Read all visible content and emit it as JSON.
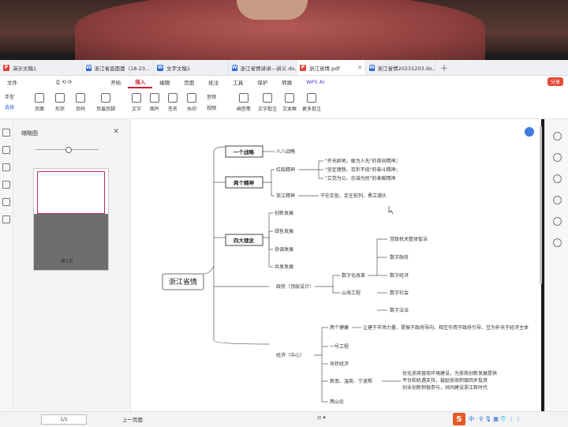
{
  "tabs": [
    {
      "label": "演示文稿1",
      "type": "p"
    },
    {
      "label": "浙江省直面面（18-23…",
      "type": "w"
    },
    {
      "label": "文字文稿1",
      "type": "w"
    },
    {
      "label": "浙江省情讲讲—讲义.do…",
      "type": "w"
    },
    {
      "label": "浙江省情.pdf",
      "type": "p",
      "active": true
    },
    {
      "label": "浙江省情20231203.do…",
      "type": "w"
    }
  ],
  "menu": {
    "file": "文件",
    "items": [
      "开始",
      "插入",
      "编辑",
      "页面",
      "批注",
      "工具",
      "保护",
      "转换"
    ],
    "ai": "WPS AI",
    "share": "分享"
  },
  "toolbar": {
    "hand": "手型",
    "select": "选择",
    "page": "页面",
    "shape": "形状",
    "page_num": "页码",
    "header_footer": "页眉页脚",
    "text": "文字",
    "image": "图片",
    "mark": "签名",
    "stamp": "水印",
    "attachment": "附件",
    "audio": "音频",
    "video": "视频",
    "draw": "画签笔",
    "text_note": "文字批注",
    "text_box": "文本框",
    "more": "更多批注"
  },
  "thumb_panel": {
    "title": "缩略图",
    "page_label": "第1页"
  },
  "mindmap": {
    "root": "浙江省情",
    "l1": [
      "一个战略",
      "两个精神",
      "四大理念"
    ],
    "strategy": "八八战略",
    "spirits": [
      "红船精神",
      "浙江精神"
    ],
    "red_boat": [
      "\"开天辟地、敢为人先\"的首创精神；",
      "\"坚定理想、百折不挠\"的奋斗精神；",
      "\"立党为公、忠诚为民\"的奉献精神"
    ],
    "zhejiang_spirit": "干在实处、走在前列、勇立潮头",
    "ideas": [
      "创新发展",
      "绿色发展",
      "协调发展",
      "共享发展"
    ],
    "gov": "政府（顶层设计）",
    "gov_children": [
      "数字化改革",
      "山海工程"
    ],
    "digital": [
      "党政机关整体智治",
      "数字政府",
      "数字经济",
      "数字社会",
      "数字法治"
    ],
    "econ": "经济（中心）",
    "econ_children": [
      "两个健康",
      "一号工程",
      "块状经济",
      "新南、温商、宁波帮",
      "两山论"
    ],
    "two_health": "让建于市场力量、提振于政府导向、相互作用于政府引导、互为补充于经济主体",
    "merchants": [
      "优化浙商营商环境建设，为浙商创新发展提供",
      "平台和机遇支持，鼓励浙商积极回乡投资",
      "创业创新积极参与，共同建设浙江新时代"
    ]
  },
  "status": {
    "page": "1/1",
    "prev": "上一页面",
    "zoom": "⊙ ▾"
  }
}
